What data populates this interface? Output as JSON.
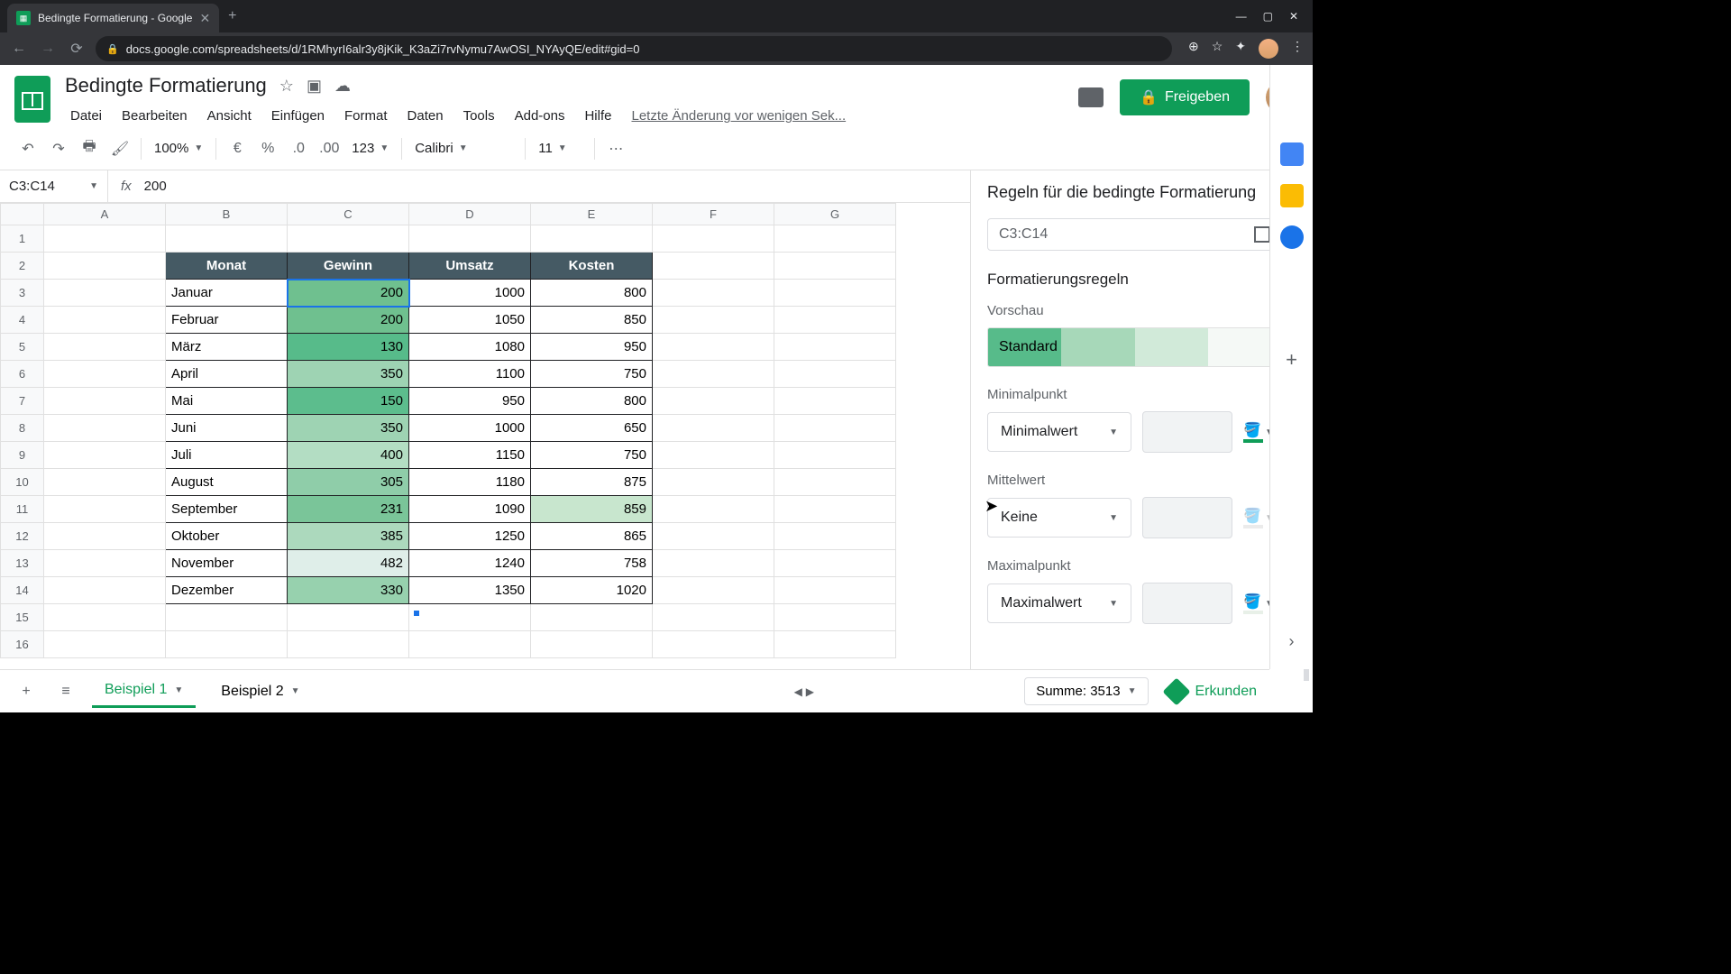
{
  "browser": {
    "tab_title": "Bedingte Formatierung - Google",
    "url": "docs.google.com/spreadsheets/d/1RMhyrI6alr3y8jKik_K3aZi7rvNymu7AwOSI_NYAyQE/edit#gid=0"
  },
  "doc": {
    "title": "Bedingte Formatierung",
    "last_edit": "Letzte Änderung vor wenigen Sek...",
    "share": "Freigeben"
  },
  "menu": {
    "file": "Datei",
    "edit": "Bearbeiten",
    "view": "Ansicht",
    "insert": "Einfügen",
    "format": "Format",
    "data": "Daten",
    "tools": "Tools",
    "addons": "Add-ons",
    "help": "Hilfe"
  },
  "toolbar": {
    "zoom": "100%",
    "font": "Calibri",
    "size": "11",
    "number_fmt": "123",
    "currency": "€",
    "percent": "%"
  },
  "namebox": "C3:C14",
  "fx_value": "200",
  "columns": [
    "A",
    "B",
    "C",
    "D",
    "E",
    "F",
    "G"
  ],
  "rows": [
    "1",
    "2",
    "3",
    "4",
    "5",
    "6",
    "7",
    "8",
    "9",
    "10",
    "11",
    "12",
    "13",
    "14",
    "15",
    "16"
  ],
  "headers": {
    "monat": "Monat",
    "gewinn": "Gewinn",
    "umsatz": "Umsatz",
    "kosten": "Kosten"
  },
  "data": [
    {
      "m": "Januar",
      "g": "200",
      "u": "1000",
      "k": "800",
      "c": "#6fc08f"
    },
    {
      "m": "Februar",
      "g": "200",
      "u": "1050",
      "k": "850",
      "c": "#6fc08f"
    },
    {
      "m": "März",
      "g": "130",
      "u": "1080",
      "k": "950",
      "c": "#57bb8a"
    },
    {
      "m": "April",
      "g": "350",
      "u": "1100",
      "k": "750",
      "c": "#9ed3b3"
    },
    {
      "m": "Mai",
      "g": "150",
      "u": "950",
      "k": "800",
      "c": "#5cbd8d"
    },
    {
      "m": "Juni",
      "g": "350",
      "u": "1000",
      "k": "650",
      "c": "#9ed3b3"
    },
    {
      "m": "Juli",
      "g": "400",
      "u": "1150",
      "k": "750",
      "c": "#b3ddc3"
    },
    {
      "m": "August",
      "g": "305",
      "u": "1180",
      "k": "875",
      "c": "#8fcda9"
    },
    {
      "m": "September",
      "g": "231",
      "u": "1090",
      "k": "859",
      "c": "#7ac599",
      "ek": "#c8e6ce"
    },
    {
      "m": "Oktober",
      "g": "385",
      "u": "1250",
      "k": "865",
      "c": "#acd9bd"
    },
    {
      "m": "November",
      "g": "482",
      "u": "1240",
      "k": "758",
      "c": "#dfeee9"
    },
    {
      "m": "Dezember",
      "g": "330",
      "u": "1350",
      "k": "1020",
      "c": "#97d1ae"
    }
  ],
  "panel": {
    "title": "Regeln für die bedingte Formatierung",
    "range": "C3:C14",
    "rules_hdr": "Formatierungsregeln",
    "preview_label": "Vorschau",
    "preview_text": "Standard",
    "min_label": "Minimalpunkt",
    "min_dd": "Minimalwert",
    "mid_label": "Mittelwert",
    "mid_dd": "Keine",
    "max_label": "Maximalpunkt",
    "max_dd": "Maximalwert"
  },
  "bottom": {
    "sheet1": "Beispiel 1",
    "sheet2": "Beispiel 2",
    "summary": "Summe: 3513",
    "explore": "Erkunden"
  },
  "colors": {
    "brand": "#0f9d58",
    "header_bg": "#455a64",
    "preview_grad": [
      "#57bb8a",
      "#a7d8b9",
      "#d1ead9",
      "#f5f9f6"
    ]
  }
}
